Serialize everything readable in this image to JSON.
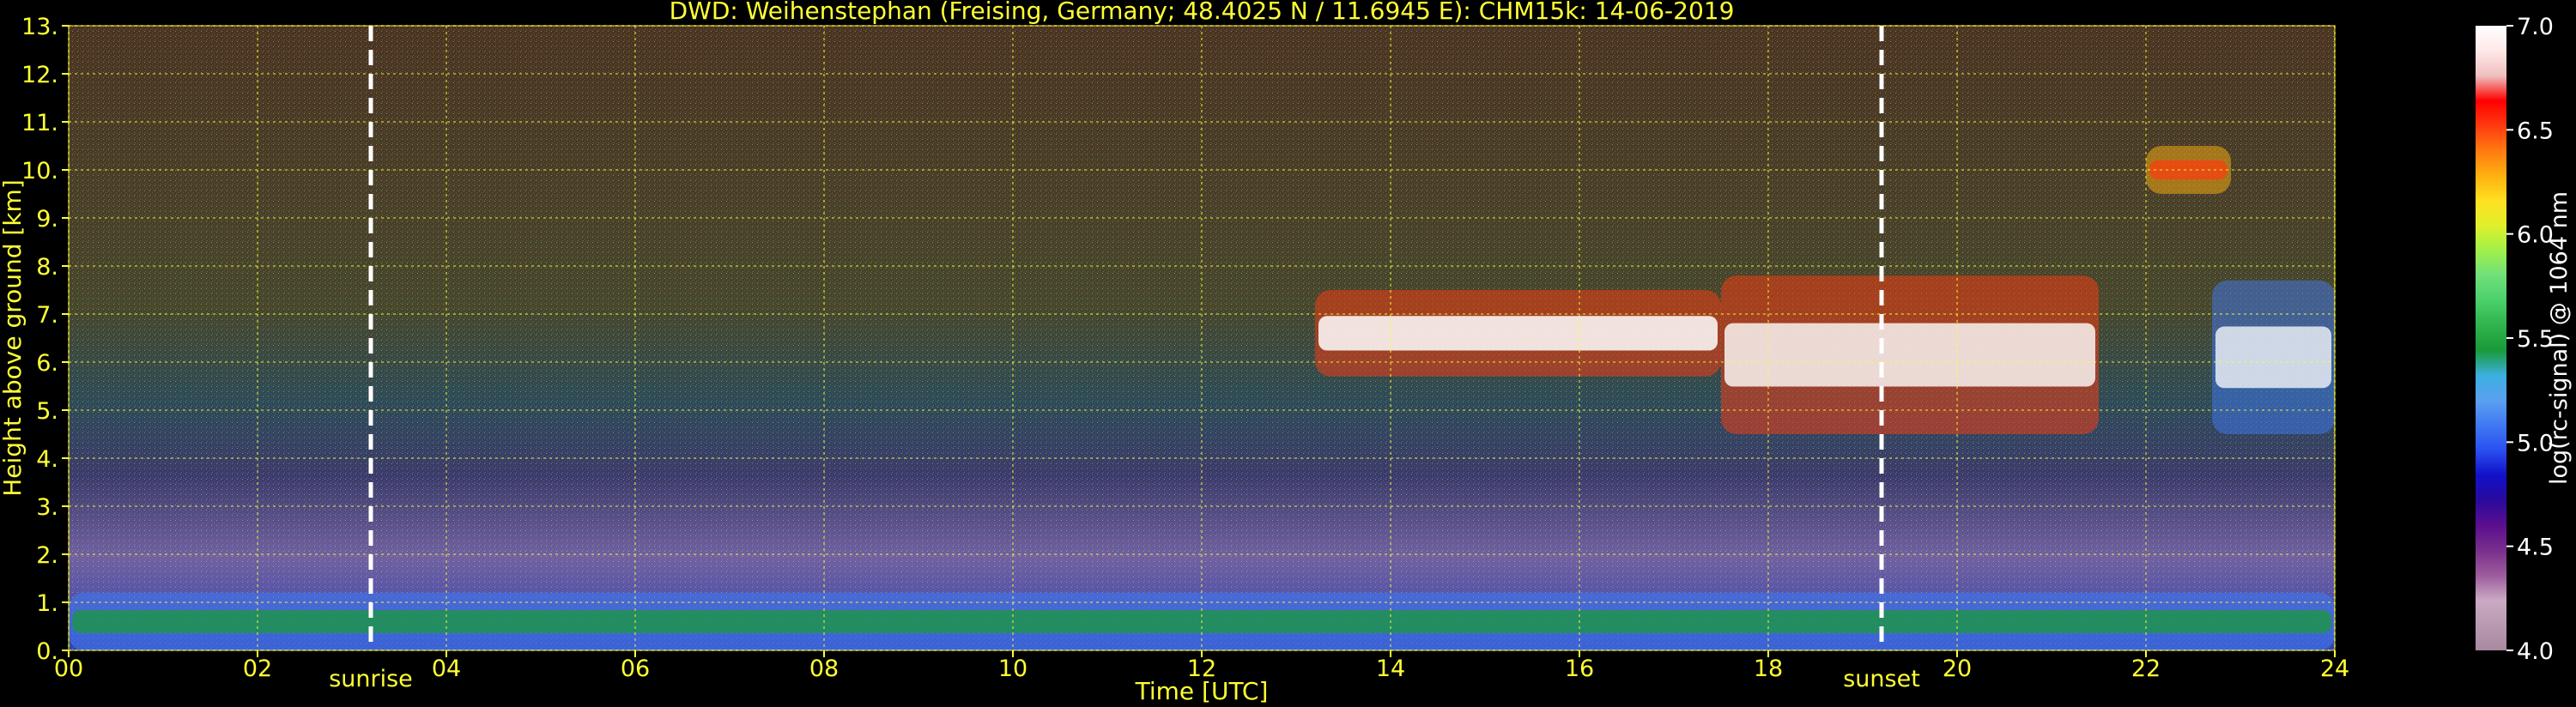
{
  "chart_data": {
    "type": "heatmap",
    "title": "DWD: Weihenstephan (Freising, Germany; 48.4025 N / 11.6945 E):    CHM15k: 14-06-2019",
    "xlabel": "Time [UTC]",
    "ylabel": "Height above ground [km]",
    "xlim": [
      0,
      24
    ],
    "ylim": [
      0,
      13
    ],
    "x_ticks": [
      "00",
      "02",
      "04",
      "06",
      "08",
      "10",
      "12",
      "14",
      "16",
      "18",
      "20",
      "22",
      "24"
    ],
    "x_tick_values": [
      0,
      2,
      4,
      6,
      8,
      10,
      12,
      14,
      16,
      18,
      20,
      22,
      24
    ],
    "y_ticks": [
      "0.",
      "1.",
      "2.",
      "3.",
      "4.",
      "5.",
      "6.",
      "7.",
      "8.",
      "9.",
      "10.",
      "11.",
      "12.",
      "13."
    ],
    "y_tick_values": [
      0,
      1,
      2,
      3,
      4,
      5,
      6,
      7,
      8,
      9,
      10,
      11,
      12,
      13
    ],
    "grid": true,
    "annotations": [
      {
        "label": "sunrise",
        "x": 3.2
      },
      {
        "label": "sunset",
        "x": 19.2
      }
    ],
    "colorbar": {
      "label": "log(rc-signal) @ 1064 nm",
      "range": [
        4.0,
        7.0
      ],
      "ticks": [
        "4.0",
        "4.5",
        "5.0",
        "5.5",
        "6.0",
        "6.5",
        "7.0"
      ],
      "tick_values": [
        4.0,
        4.5,
        5.0,
        5.5,
        6.0,
        6.5,
        7.0
      ],
      "colors": [
        "#a78aa0",
        "#b79ab2",
        "#cba9c3",
        "#9c5c9c",
        "#7a2e8c",
        "#5a0f8f",
        "#2a0a9c",
        "#1010c8",
        "#2a4ef0",
        "#3f78f2",
        "#5aa0f0",
        "#3bb0e0",
        "#1a9a3a",
        "#2fb34a",
        "#4ad06a",
        "#6fe07a",
        "#a0f04a",
        "#dff02a",
        "#ffe020",
        "#ffb010",
        "#ff7a10",
        "#ff3a10",
        "#ff0000",
        "#f0c0c0",
        "#ffe8e8",
        "#ffffff"
      ]
    },
    "features": [
      {
        "name": "boundary-layer",
        "x_range": [
          0,
          24
        ],
        "height_km": [
          0,
          1.2
        ]
      },
      {
        "name": "cloud-layer-1",
        "x_range": [
          13.2,
          17.5
        ],
        "height_km": [
          5.7,
          7.5
        ]
      },
      {
        "name": "cloud-layer-2",
        "x_range": [
          17.5,
          21.5
        ],
        "height_km": [
          4.5,
          7.8
        ]
      },
      {
        "name": "cloud-layer-3",
        "x_range": [
          22.7,
          24
        ],
        "height_km": [
          4.5,
          7.7
        ]
      },
      {
        "name": "high-cloud",
        "x_range": [
          22,
          22.9
        ],
        "height_km": [
          9.5,
          10.5
        ]
      }
    ]
  }
}
